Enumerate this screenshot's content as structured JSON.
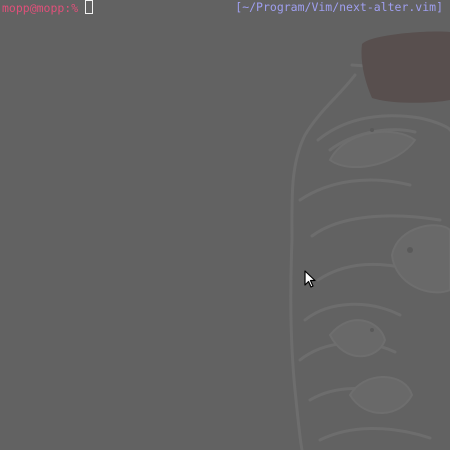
{
  "terminal": {
    "prompt": "mopp@mopp:%",
    "right_prompt": "[~/Program/Vim/next-alter.vim]"
  },
  "colors": {
    "background": "#626262",
    "prompt": "#e0507a",
    "right_prompt": "#9f9ff0",
    "cursor": "#f2f2f2"
  },
  "icons": {
    "mouse": "mouse-pointer-icon",
    "wallpaper": "fish-in-jar-wallpaper"
  }
}
